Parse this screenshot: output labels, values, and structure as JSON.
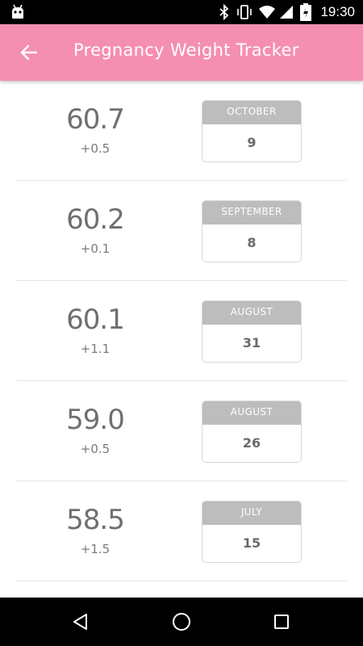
{
  "status_bar": {
    "time": "19:30"
  },
  "app_bar": {
    "title": "Pregnancy Weight Tracker"
  },
  "entries": [
    {
      "weight": "60.7",
      "delta": "+0.5",
      "month": "OCTOBER",
      "day": "9"
    },
    {
      "weight": "60.2",
      "delta": "+0.1",
      "month": "SEPTEMBER",
      "day": "8"
    },
    {
      "weight": "60.1",
      "delta": "+1.1",
      "month": "AUGUST",
      "day": "31"
    },
    {
      "weight": "59.0",
      "delta": "+0.5",
      "month": "AUGUST",
      "day": "26"
    },
    {
      "weight": "58.5",
      "delta": "+1.5",
      "month": "JULY",
      "day": "15"
    }
  ],
  "colors": {
    "app_bar": "#f48fb1",
    "month_header": "#bdbdbd",
    "text": "#6f6f6f"
  }
}
